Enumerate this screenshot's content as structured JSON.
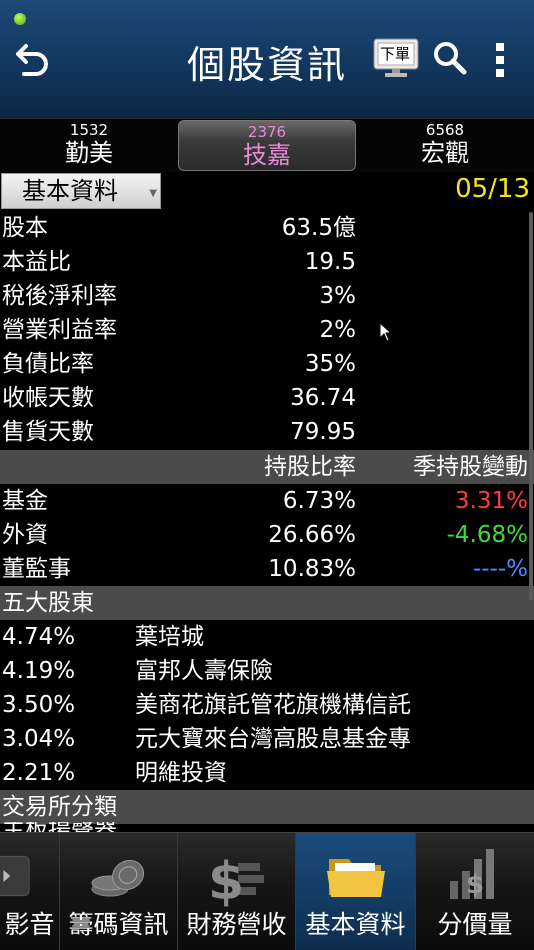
{
  "header": {
    "title": "個股資訊",
    "order_label": "下單",
    "icons": [
      "back-icon",
      "order-monitor-icon",
      "search-icon",
      "more-vert-icon"
    ]
  },
  "stock_tabs": [
    {
      "code": "1532",
      "name": "勤美"
    },
    {
      "code": "2376",
      "name": "技嘉",
      "active": true
    },
    {
      "code": "6568",
      "name": "宏觀"
    }
  ],
  "sub_header": {
    "dropdown_value": "基本資料",
    "date": "05/13"
  },
  "basic": [
    {
      "label": "股本",
      "value": "63.5億"
    },
    {
      "label": "本益比",
      "value": "19.5"
    },
    {
      "label": "稅後淨利率",
      "value": "3%"
    },
    {
      "label": "營業利益率",
      "value": "2%"
    },
    {
      "label": "負債比率",
      "value": "35%"
    },
    {
      "label": "收帳天數",
      "value": "36.74"
    },
    {
      "label": "售貨天數",
      "value": "79.95"
    }
  ],
  "holding_header": {
    "col1": "持股比率",
    "col2": "季持股變動"
  },
  "holdings": [
    {
      "label": "基金",
      "ratio": "6.73%",
      "change": "3.31%",
      "color": "#ff3b3b"
    },
    {
      "label": "外資",
      "ratio": "26.66%",
      "change": "-4.68%",
      "color": "#3ddc38"
    },
    {
      "label": "董監事",
      "ratio": "10.83%",
      "change": "----%",
      "color": "#4d8cff"
    }
  ],
  "top5_title": "五大股東",
  "top5": [
    {
      "pct": "4.74%",
      "name": "葉培城"
    },
    {
      "pct": "4.19%",
      "name": "富邦人壽保險"
    },
    {
      "pct": "3.50%",
      "name": "美商花旗託管花旗機構信託"
    },
    {
      "pct": "3.04%",
      "name": "元大寶來台灣高股息基金專"
    },
    {
      "pct": "2.21%",
      "name": "明維投資"
    }
  ],
  "exchange_title": "交易所分類",
  "partial_text": "主板揚聲器",
  "bottom_nav": [
    {
      "label": "影音",
      "icon": "video-icon"
    },
    {
      "label": "籌碼資訊",
      "icon": "coins-icon"
    },
    {
      "label": "財務營收",
      "icon": "dollar-icon"
    },
    {
      "label": "基本資料",
      "icon": "folder-icon",
      "active": true
    },
    {
      "label": "分價量",
      "icon": "volume-bars-icon"
    }
  ]
}
